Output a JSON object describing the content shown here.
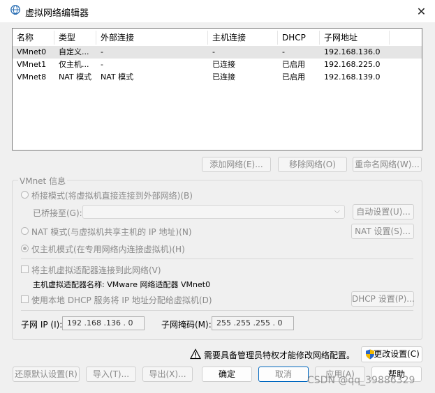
{
  "window": {
    "title": "虚拟网络编辑器",
    "close_glyph": "✕"
  },
  "table": {
    "headers": [
      "名称",
      "类型",
      "外部连接",
      "主机连接",
      "DHCP",
      "子网地址"
    ],
    "rows": [
      [
        "VMnet0",
        "自定义...",
        "-",
        "-",
        "-",
        "192.168.136.0"
      ],
      [
        "VMnet1",
        "仅主机...",
        "-",
        "已连接",
        "已启用",
        "192.168.225.0"
      ],
      [
        "VMnet8",
        "NAT 模式",
        "NAT 模式",
        "已连接",
        "已启用",
        "192.168.139.0"
      ]
    ]
  },
  "table_buttons": {
    "add": "添加网络(E)...",
    "remove": "移除网络(O)",
    "rename": "重命名网络(W)..."
  },
  "vmnet_info": {
    "group_title": "VMnet 信息",
    "bridge_label": "桥接模式(将虚拟机直接连接到外部网络)(B)",
    "bridged_to_label": "已桥接至(G):",
    "auto_settings": "自动设置(U)...",
    "nat_label": "NAT 模式(与虚拟机共享主机的 IP 地址)(N)",
    "nat_settings": "NAT 设置(S)...",
    "hostonly_label": "仅主机模式(在专用网络内连接虚拟机)(H)",
    "connect_adapter_label": "将主机虚拟适配器连接到此网络(V)",
    "adapter_name": "主机虚拟适配器名称: VMware 网络适配器 VMnet0",
    "dhcp_label": "使用本地 DHCP 服务将 IP 地址分配给虚拟机(D)",
    "dhcp_settings": "DHCP 设置(P)...",
    "subnet_ip_label": "子网 IP (I):",
    "subnet_ip_value": "192 .168 .136 . 0",
    "subnet_mask_label": "子网掩码(M):",
    "subnet_mask_value": "255 .255 .255 . 0"
  },
  "admin": {
    "warning": "需要具备管理员特权才能修改网络配置。",
    "change_settings": "更改设置(C)"
  },
  "footer": {
    "restore": "还原默认设置(R)",
    "import": "导入(T)...",
    "export": "导出(X)...",
    "ok": "确定",
    "cancel": "取消",
    "apply": "应用(A)",
    "help": "帮助"
  },
  "watermark": "CSDN @qq_39886329"
}
